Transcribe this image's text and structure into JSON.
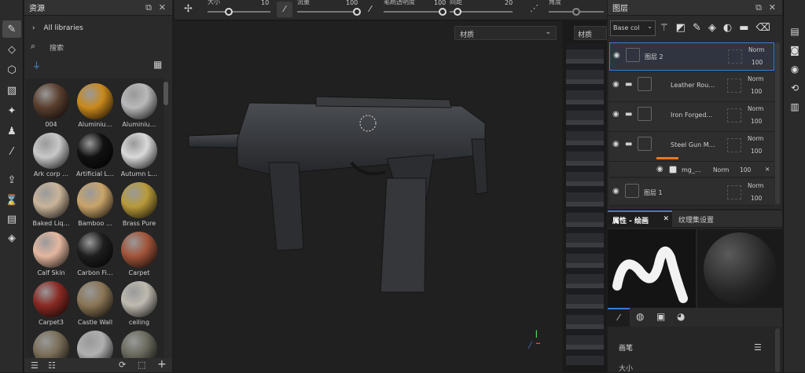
{
  "tools": [
    "brush-icon",
    "eraser-icon",
    "projection-icon",
    "polygon-fill-icon",
    "geometry-mask-icon",
    "clone-stamp-icon",
    "color-picker-icon",
    "export-icon",
    "bake-icon",
    "document-icon",
    "cube-icon"
  ],
  "assets": {
    "title": "资源",
    "library_path": "All libraries",
    "search_placeholder": "搜索",
    "materials": [
      {
        "name": "004",
        "color": "#5a3f2e"
      },
      {
        "name": "Aluminiu…",
        "color": "#c9891d"
      },
      {
        "name": "Aluminiu…",
        "color": "#b9b9b9"
      },
      {
        "name": "Ark corp …",
        "color": "#c8c8c8"
      },
      {
        "name": "Artificial L…",
        "color": "#111111"
      },
      {
        "name": "Autumn L…",
        "color": "#d9d9d9"
      },
      {
        "name": "Baked Liq…",
        "color": "#c9b49a"
      },
      {
        "name": "Bamboo …",
        "color": "#c9a46a"
      },
      {
        "name": "Brass Pure",
        "color": "#b89a3a"
      },
      {
        "name": "Calf Skin",
        "color": "#e4b7a0"
      },
      {
        "name": "Carbon Fi…",
        "color": "#1e1e1e"
      },
      {
        "name": "Carpet",
        "color": "#a2553a"
      },
      {
        "name": "Carpet3",
        "color": "#8a2a24"
      },
      {
        "name": "Castle Wall",
        "color": "#8a7555"
      },
      {
        "name": "ceiling",
        "color": "#bfbab0"
      },
      {
        "name": "",
        "color": "#7a6e58"
      },
      {
        "name": "",
        "color": "#b0b0b0"
      },
      {
        "name": "",
        "color": "#6a6a5e"
      }
    ]
  },
  "toolbar": {
    "size_label": "大小",
    "size_value": "10",
    "flow_label": "流量",
    "flow_value": "100",
    "opacity_label": "笔刷透明度",
    "opacity_value": "100",
    "spacing_label": "间距",
    "spacing_value": "20",
    "angle_label": "角度"
  },
  "viewport": {
    "material_dropdown": "材质",
    "uv_material_dropdown": "材质"
  },
  "layers": {
    "title": "图层",
    "channel_select": "Base col",
    "items": [
      {
        "name": "图层 2",
        "blend": "Norm",
        "opacity": "100",
        "selected": true
      },
      {
        "name": "Leather Rou…",
        "blend": "Norm",
        "opacity": "100",
        "selected": false
      },
      {
        "name": "Iron Forged…",
        "blend": "Norm",
        "opacity": "100",
        "selected": false
      },
      {
        "name": "Steel Gun M…",
        "blend": "Norm",
        "opacity": "100",
        "selected": false
      },
      {
        "name": "mg_…",
        "blend": "Norm",
        "opacity": "100",
        "selected": false
      },
      {
        "name": "图层 1",
        "blend": "Norm",
        "opacity": "100",
        "selected": false
      }
    ]
  },
  "properties": {
    "tab_paint": "属性 - 绘画",
    "tab_texture_set": "纹理集设置",
    "brush_section": "画笔",
    "size_label": "大小"
  },
  "colors": {
    "accent": "#3a7bd5",
    "orange": "#e87722"
  }
}
